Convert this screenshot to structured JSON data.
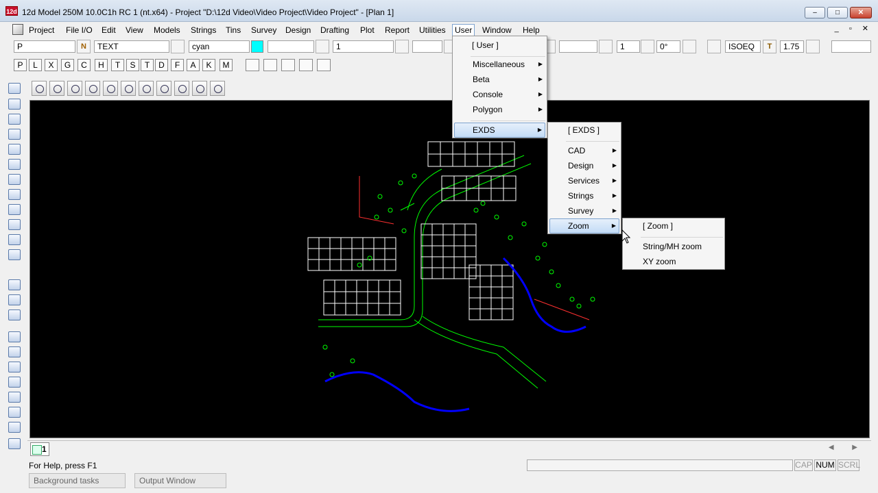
{
  "window": {
    "app_icon": "12d",
    "title": "12d Model 250M 10.0C1h RC 1 (nt.x64) - Project \"D:\\12d Video\\Video Project\\Video Project\" - [Plan 1]",
    "min": "–",
    "max": "□",
    "close": "✕"
  },
  "menubar": {
    "items": [
      "Project",
      "File I/O",
      "Edit",
      "View",
      "Models",
      "Strings",
      "Tins",
      "Survey",
      "Design",
      "Drafting",
      "Plot",
      "Report",
      "Utilities",
      "User",
      "Window",
      "Help"
    ],
    "mdi_controls": "_ ▫ ✕"
  },
  "toolbar": {
    "model_value": "P",
    "model_btn": "N",
    "text_value": "TEXT",
    "colour_value": "cyan",
    "colour_swatch": "#00ffff",
    "weight_value": "1",
    "style_value": "1",
    "angle_value": "0°",
    "textstyle_value": "ISOEQ",
    "textstyle_btn": "T",
    "size_value": "1.75"
  },
  "snap_letters": [
    "P",
    "L",
    "X",
    "G",
    "C",
    "H",
    "T",
    "S",
    "T",
    "D",
    "F",
    "A",
    "K",
    "M"
  ],
  "plan_tab": {
    "label": "1"
  },
  "status": {
    "help_text": "For Help, press F1",
    "cap": "CAP",
    "num": "NUM",
    "scrl": "SCRL"
  },
  "bottom_tabs": {
    "background": "Background tasks",
    "output": "Output Window"
  },
  "user_menu": {
    "header": "[ User ]",
    "items": [
      "Miscellaneous",
      "Beta",
      "Console",
      "Polygon",
      "EXDS"
    ],
    "highlighted": "EXDS"
  },
  "exds_menu": {
    "header": "[ EXDS ]",
    "items": [
      "CAD",
      "Design",
      "Services",
      "Strings",
      "Survey",
      "Zoom"
    ],
    "highlighted": "Zoom"
  },
  "zoom_menu": {
    "header": "[ Zoom ]",
    "items": [
      "String/MH zoom",
      "XY zoom"
    ]
  },
  "colors": {
    "lot_lines": "#ffffff",
    "road_lines": "#00ff00",
    "water": "#0000ff",
    "boundary": "#ff3030"
  }
}
